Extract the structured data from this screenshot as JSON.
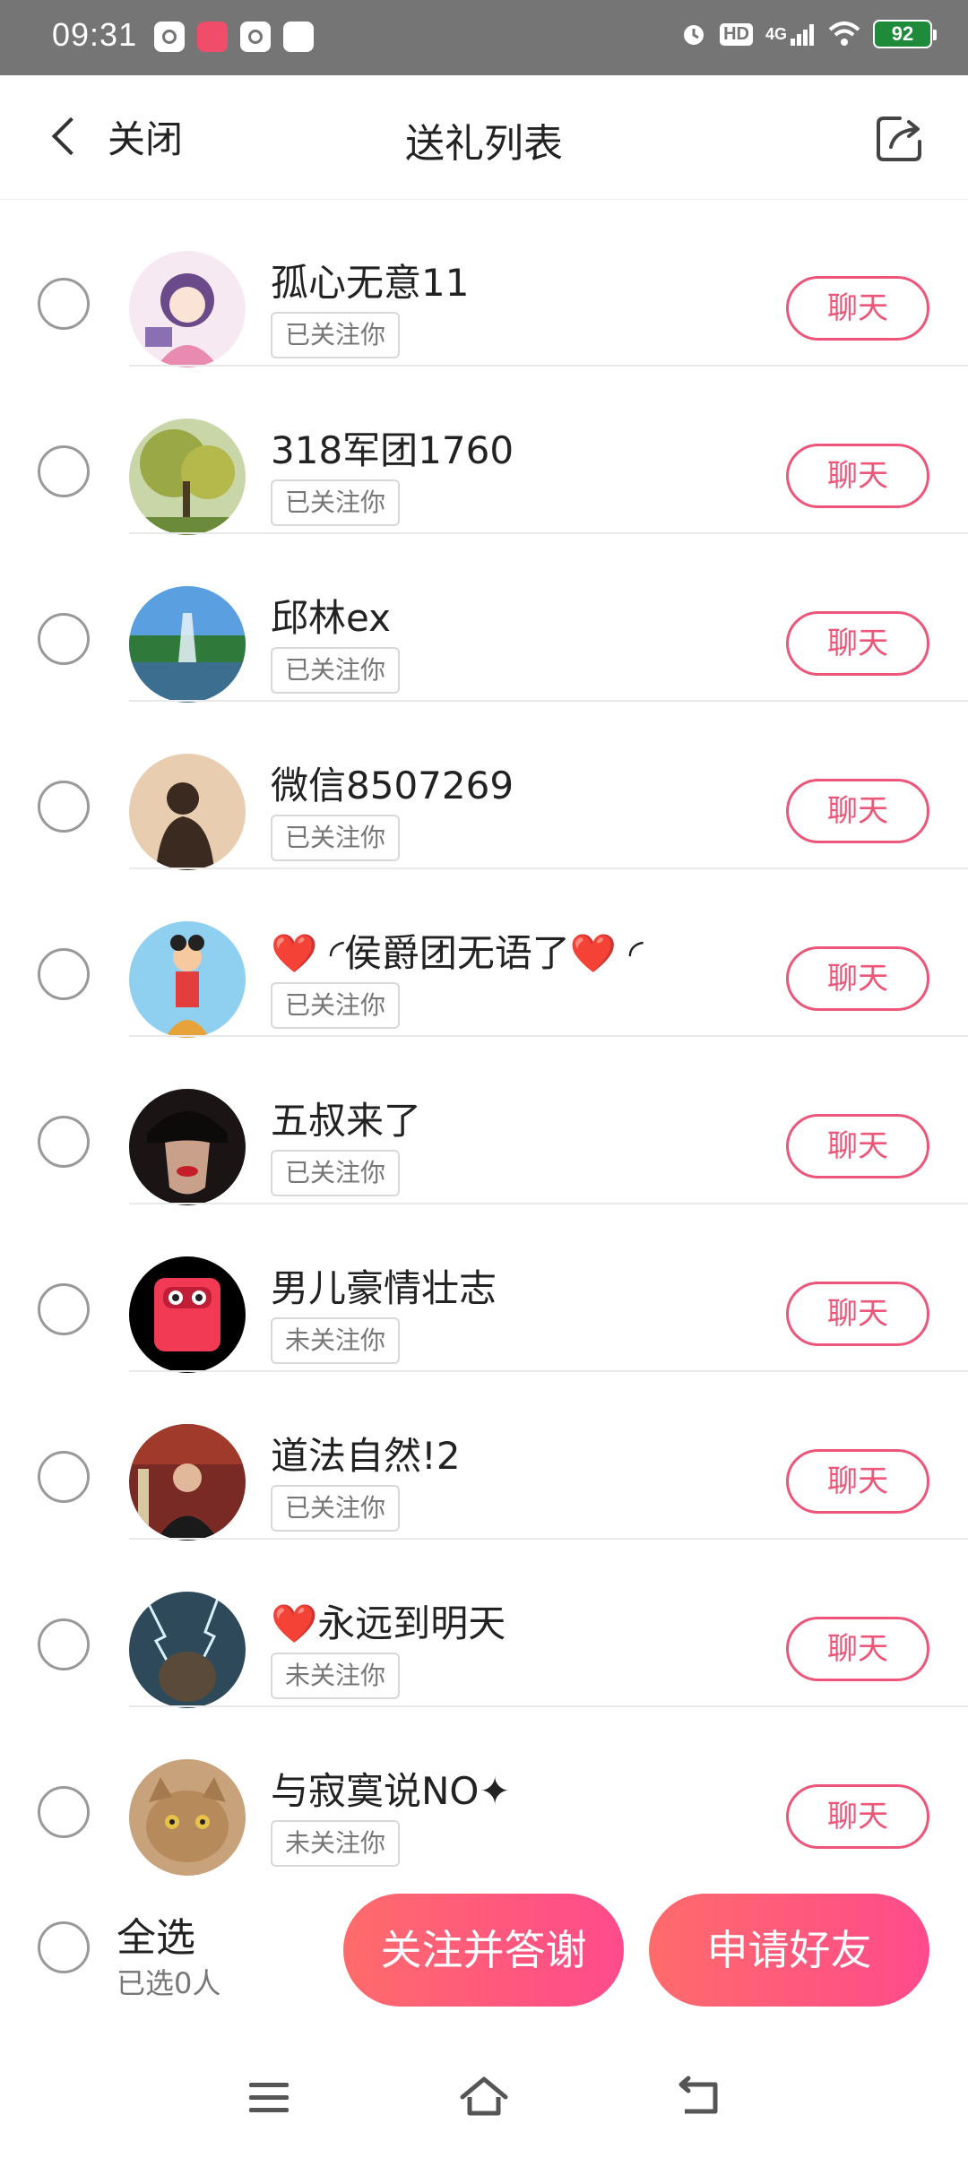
{
  "status_bar": {
    "time": "09:31",
    "network": "4G",
    "hd": "HD",
    "battery": "92"
  },
  "header": {
    "back_label": "关闭",
    "title": "送礼列表"
  },
  "items": [
    {
      "name": "孤心无意11",
      "follow_status": "已关注你",
      "chat_label": "聊天"
    },
    {
      "name": "318军团1760",
      "follow_status": "已关注你",
      "chat_label": "聊天"
    },
    {
      "name": "邱林ex",
      "follow_status": "已关注你",
      "chat_label": "聊天"
    },
    {
      "name": "微信8507269",
      "follow_status": "已关注你",
      "chat_label": "聊天"
    },
    {
      "name": "❤️ ◜侯爵团无语了❤️ ◜",
      "follow_status": "已关注你",
      "chat_label": "聊天"
    },
    {
      "name": "五叔来了",
      "follow_status": "已关注你",
      "chat_label": "聊天"
    },
    {
      "name": "男儿豪情壮志",
      "follow_status": "未关注你",
      "chat_label": "聊天"
    },
    {
      "name": "道法自然!2",
      "follow_status": "已关注你",
      "chat_label": "聊天"
    },
    {
      "name": "❤️永远到明天",
      "follow_status": "未关注你",
      "chat_label": "聊天"
    },
    {
      "name": "与寂寞说NO✦",
      "follow_status": "未关注你",
      "chat_label": "聊天"
    }
  ],
  "bottom_bar": {
    "select_all_label": "全选",
    "selected_count": "已选0人",
    "follow_thank_label": "关注并答谢",
    "add_friend_label": "申请好友"
  },
  "colors": {
    "accent": "#ee5679",
    "gradient_start": "#ff6b6b",
    "gradient_end": "#ff4a8c",
    "status_bar_bg": "#757575",
    "battery": "#1f8a3a"
  }
}
